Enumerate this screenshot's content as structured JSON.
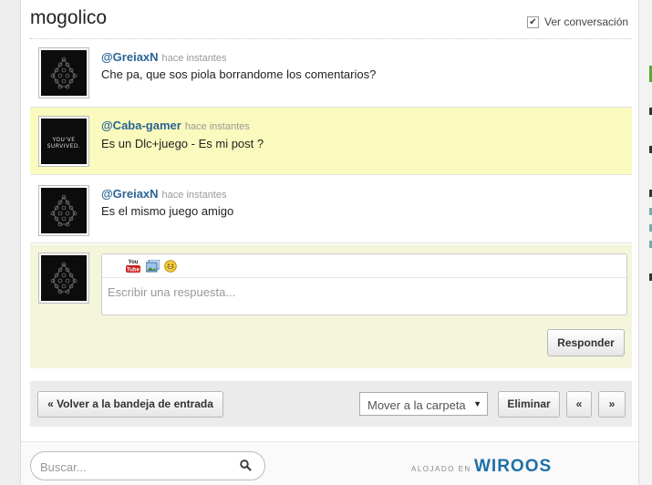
{
  "page": {
    "title": "mogolico"
  },
  "view_conversation": {
    "label": "Ver conversación",
    "checked": true
  },
  "messages": [
    {
      "user": "@GreiaxN",
      "time": "hace instantes",
      "text": "Che pa, que sos piola borrandome los comentarios?",
      "avatar": "geometric-pattern",
      "highlighted": false
    },
    {
      "user": "@Caba-gamer",
      "time": "hace instantes",
      "text": "Es un Dlc+juego - Es mi post ?",
      "avatar": "you-survived",
      "avatar_text": "YOU'VE SURVIVED.",
      "highlighted": true
    },
    {
      "user": "@GreiaxN",
      "time": "hace instantes",
      "text": "Es el mismo juego amigo",
      "avatar": "geometric-pattern",
      "highlighted": false
    }
  ],
  "reply": {
    "placeholder": "Escribir una respuesta...",
    "tools": [
      "youtube-icon",
      "image-icon",
      "emoticon-icon"
    ],
    "youtube_label_top": "You",
    "youtube_label_bottom": "Tube",
    "submit_label": "Responder"
  },
  "actions": {
    "back_label": "« Volver a la bandeja de entrada",
    "move_label": "Mover a la carpeta",
    "delete_label": "Eliminar",
    "prev_label": "«",
    "next_label": "»"
  },
  "footer": {
    "search_placeholder": "Buscar...",
    "hosted_label": "ALOJADO EN",
    "brand": "WIROOS"
  },
  "colors": {
    "username": "#2a6496",
    "highlight": "#fafabe",
    "reply_bg": "#f5f5dc",
    "brand": "#1e6fa8"
  }
}
